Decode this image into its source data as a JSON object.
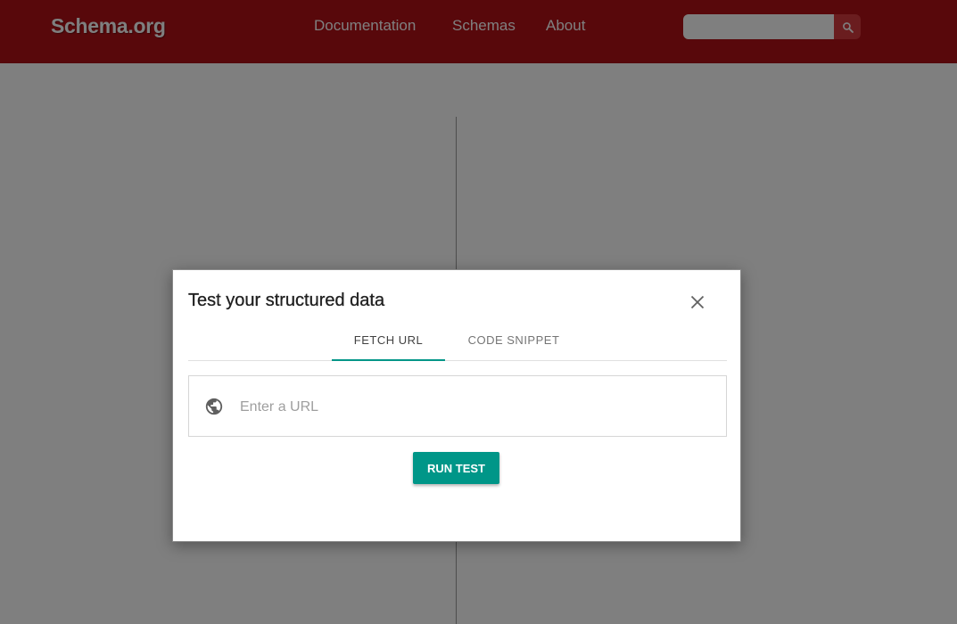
{
  "header": {
    "logo": "Schema.org",
    "nav": [
      "Documentation",
      "Schemas",
      "About"
    ],
    "search": {
      "value": "",
      "placeholder": ""
    },
    "colors": {
      "brand": "#b01117"
    }
  },
  "dialog": {
    "title": "Test your structured data",
    "tabs": [
      {
        "label": "FETCH URL",
        "active": true
      },
      {
        "label": "CODE SNIPPET",
        "active": false
      }
    ],
    "url_input": {
      "value": "",
      "placeholder": "Enter a URL"
    },
    "run_button": "RUN TEST",
    "colors": {
      "accent": "#009688"
    },
    "icons": {
      "close": "close-icon",
      "globe": "globe-icon",
      "search": "search-icon"
    }
  }
}
